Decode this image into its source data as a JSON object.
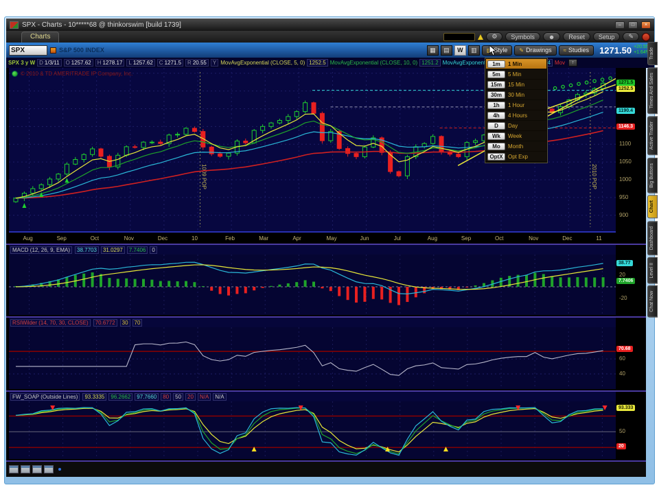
{
  "window": {
    "title": "SPX - Charts - 10*****68 @ thinkorswim [build 1739]"
  },
  "menubar": {
    "charts_tab": "Charts"
  },
  "toolbar": {
    "symbols": "Symbols",
    "reset": "Reset",
    "setup": "Setup"
  },
  "symbol_row": {
    "symbol": "SPX",
    "description": "S&P 500 INDEX",
    "timeframe_button": "W",
    "style": "Style",
    "drawings": "Drawings",
    "studies": "Studies",
    "price": "1271.50",
    "change": "+20.55",
    "change_pct": "+1.64%"
  },
  "databar": {
    "symbol_info": "SPX 3 y W",
    "fields": [
      [
        "D",
        "1/3/11"
      ],
      [
        "O",
        "1257.62"
      ],
      [
        "H",
        "1278.17"
      ],
      [
        "L",
        "1257.62"
      ],
      [
        "C",
        "1271.5"
      ],
      [
        "R",
        "20.55"
      ],
      [
        "Y",
        ""
      ]
    ],
    "studies": [
      {
        "label": "MovAvgExponential (CLOSE, 5, 0)",
        "value": "1252.5",
        "color": "#d8d858"
      },
      {
        "label": "MovAvgExponential (CLOSE, 10, 0)",
        "value": "1251.2",
        "color": "#2ab84a"
      },
      {
        "label": "MovAvgExponential (CLOSE, 20, 0)",
        "value": "1190.4",
        "color": "#35d8d8"
      },
      {
        "label": "Mov",
        "value": "",
        "color": "#e03030"
      }
    ]
  },
  "timeframe_menu": {
    "items": [
      {
        "key": "1m",
        "label": "1 Min",
        "selected": true
      },
      {
        "key": "5m",
        "label": "5 Min"
      },
      {
        "key": "15m",
        "label": "15 Min"
      },
      {
        "key": "30m",
        "label": "30 Min"
      },
      {
        "key": "1h",
        "label": "1 Hour"
      },
      {
        "key": "4h",
        "label": "4 Hours"
      },
      {
        "key": "D",
        "label": "Day"
      },
      {
        "key": "Wk",
        "label": "Week"
      },
      {
        "key": "Mo",
        "label": "Month"
      },
      {
        "key": "OptX",
        "label": "Opt Exp"
      }
    ]
  },
  "main_chart": {
    "copyright": "© 2010 & TD AMERITRADE IP Company, Inc.",
    "months": [
      "Aug",
      "Sep",
      "Oct",
      "Nov",
      "Dec",
      "10",
      "Feb",
      "Mar",
      "Apr",
      "May",
      "Jun",
      "Jul",
      "Aug",
      "Sep",
      "Oct",
      "Nov",
      "Dec",
      "11"
    ],
    "y_ticks": [
      1100,
      1050,
      1000,
      950,
      900
    ],
    "y_domain": [
      855,
      1315
    ],
    "closes": [
      948,
      962,
      975,
      986,
      1002,
      1016,
      1044,
      1057,
      1071,
      1087,
      1066,
      1036,
      1069,
      1093,
      1091,
      1106,
      1106,
      1102,
      1126,
      1128,
      1145,
      1136,
      1092,
      1073,
      1066,
      1075,
      1109,
      1104,
      1139,
      1150,
      1160,
      1167,
      1178,
      1192,
      1217,
      1187,
      1110,
      1136,
      1088,
      1074,
      1065,
      1092,
      1118,
      1077,
      1023,
      1011,
      1065,
      1093,
      1102,
      1122,
      1079,
      1072,
      1065,
      1105,
      1110,
      1126,
      1149,
      1165,
      1176,
      1183,
      1183,
      1226,
      1199,
      1189,
      1206,
      1225,
      1240,
      1244,
      1257,
      1272
    ],
    "badges": [
      {
        "v": 1271.5,
        "t": "1271.5",
        "bg": "#1fc42a",
        "fg": "#002a00"
      },
      {
        "v": 1252.5,
        "t": "1252.5",
        "bg": "#e8e83c",
        "fg": "#222200"
      },
      {
        "v": 1190.4,
        "t": "1190.4",
        "bg": "#35d8d8",
        "fg": "#002a2a"
      },
      {
        "v": 1146.3,
        "t": "1146.3",
        "bg": "#e82020",
        "fg": "#ffffff"
      }
    ],
    "dashed_levels": [
      {
        "v": 1252,
        "from": 0.5,
        "color": "#35d8d8"
      },
      {
        "v": 1205,
        "from": 0.53,
        "color": "#9898b8"
      },
      {
        "v": 1146,
        "from": 0.71,
        "color": "#d02020"
      }
    ],
    "trendlines": [
      {
        "x1": 0.74,
        "v1": 1040,
        "x2": 1.0,
        "v2": 1285,
        "color": "#e8e838"
      },
      {
        "x1": 0.84,
        "v1": 1172,
        "x2": 1.0,
        "v2": 1268,
        "color": "#e8e838"
      }
    ],
    "projection_dots": {
      "start": 0.9,
      "count": 8,
      "v0": 1258,
      "dv": 4,
      "color": "#1fd12f"
    },
    "buy_arrows": [
      1,
      3,
      6
    ],
    "annotations": [
      {
        "x": 0.315,
        "label": "1009 POP"
      },
      {
        "x": 0.958,
        "label": "2010 POP"
      }
    ]
  },
  "macd": {
    "title": "MACD (12, 26, 9, EMA)",
    "values": [
      {
        "t": "38.7703",
        "c": "#58d8d8"
      },
      {
        "t": "31.0297",
        "c": "#d8d858"
      },
      {
        "t": "7.7406",
        "c": "#2ab84a"
      },
      {
        "t": "0",
        "c": "#c8c8c8"
      }
    ],
    "badges": [
      {
        "v": 38.77,
        "t": "38.77",
        "bg": "#35d8d8",
        "fg": "#002a2a"
      },
      {
        "v": 7.74,
        "t": "7.7406",
        "bg": "#1fa32a",
        "fg": "#eaffea"
      }
    ],
    "ticks": [
      20,
      -20
    ],
    "params": {
      "fast": 12,
      "slow": 26,
      "signal": 9
    }
  },
  "rsi": {
    "title": "RSIWilder (14, 70, 30, CLOSE)",
    "value": "70.6772",
    "levels": [
      "30",
      "70"
    ],
    "line_level": 70,
    "ticks": [
      60,
      40
    ],
    "badge": {
      "v": 72,
      "t": "70.68",
      "bg": "#e82020",
      "fg": "#ffffff"
    }
  },
  "soap": {
    "title": "FW_SOAP (Outside Lines)",
    "values": [
      {
        "t": "93.3335",
        "c": "#d8d858"
      },
      {
        "t": "96.2662",
        "c": "#2ab84a"
      },
      {
        "t": "97.7660",
        "c": "#58d8d8"
      },
      {
        "t": "80",
        "c": "#d04040"
      },
      {
        "t": "50",
        "c": "#c8c8c8"
      },
      {
        "t": "20",
        "c": "#d04040"
      },
      {
        "t": "N/A",
        "c": "#d04040"
      },
      {
        "t": "N/A",
        "c": "#c8c8c8"
      }
    ],
    "badges": [
      {
        "v": 93.3,
        "t": "93.333",
        "bg": "#e8e83c",
        "fg": "#222200"
      },
      {
        "v": 20,
        "t": "20",
        "bg": "#e82020",
        "fg": "#ffffff"
      }
    ],
    "ticks": [
      50
    ],
    "levels": [
      {
        "v": 80,
        "color": "#8b0000"
      },
      {
        "v": 50,
        "color": "#66667a"
      },
      {
        "v": 20,
        "color": "#8b0000"
      }
    ],
    "arrows": [
      {
        "f": 0.072,
        "d": "down"
      },
      {
        "f": 0.404,
        "d": "up"
      },
      {
        "f": 0.481,
        "d": "down"
      },
      {
        "f": 0.624,
        "d": "up"
      },
      {
        "f": 0.72,
        "d": "up"
      },
      {
        "f": 0.839,
        "d": "down"
      },
      {
        "f": 0.982,
        "d": "down"
      }
    ]
  },
  "side_tabs": [
    {
      "label": "Trade"
    },
    {
      "label": "Times And Sales"
    },
    {
      "label": "Active Trader"
    },
    {
      "label": "Big Buttons"
    },
    {
      "label": "Chart",
      "selected": true
    },
    {
      "label": "Dashboard"
    },
    {
      "label": "Level II"
    },
    {
      "label": "Chat Now"
    }
  ],
  "taskbar": {
    "icons": [
      "layout-grid-icon",
      "layout-window-icon",
      "layout-window-icon",
      "layout-window-icon"
    ]
  }
}
